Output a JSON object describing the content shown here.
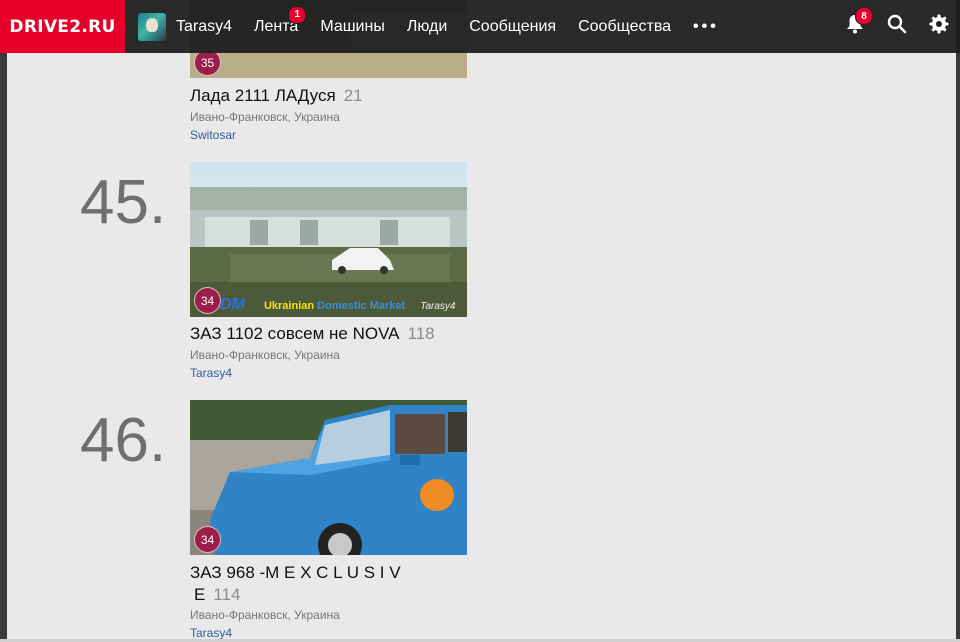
{
  "nav": {
    "logo": "DRIVE2.RU",
    "user": "Tarasy4",
    "items": [
      {
        "label": "Лента",
        "badge": "1"
      },
      {
        "label": "Машины"
      },
      {
        "label": "Люди"
      },
      {
        "label": "Сообщения"
      },
      {
        "label": "Сообщества"
      }
    ],
    "more": "•••",
    "notifications_badge": "8"
  },
  "entries": [
    {
      "title": "Лада 2111 ЛАДуся",
      "count": "21",
      "location": "Ивано-Франковск, Украина",
      "owner": "Switosar",
      "pill": "35"
    },
    {
      "rank": "45.",
      "title": "ЗАЗ 1102 совсем не NOVA",
      "count": "118",
      "location": "Ивано-Франковск, Украина",
      "owner": "Tarasy4",
      "pill": "34",
      "watermark": {
        "a": "DM",
        "b": "Ukrainian",
        "c": "Domestic Market",
        "d": "Tarasy4"
      }
    },
    {
      "rank": "46.",
      "title_line1": "ЗАЗ 968 -M E X C L U S I V",
      "title_line2": "E",
      "count": "114",
      "location": "Ивано-Франковск, Украина",
      "owner": "Tarasy4",
      "pill": "34"
    }
  ],
  "colors": {
    "brand": "#e6002a",
    "topbar": "#1e1e1e",
    "badge": "#9b1d4a",
    "link": "#2f5e9b"
  }
}
